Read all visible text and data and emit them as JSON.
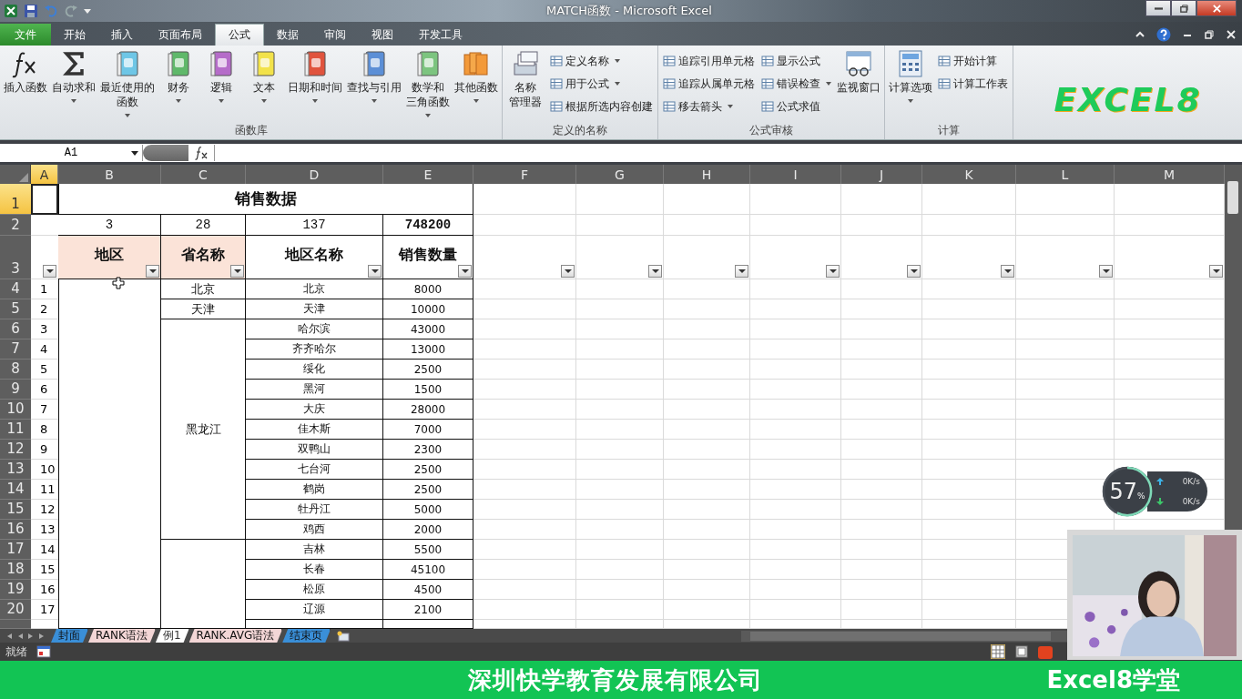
{
  "window": {
    "title": "MATCH函数 - Microsoft Excel"
  },
  "file_menu": {
    "label": "文件"
  },
  "menu_tabs": [
    {
      "label": "开始",
      "selected": false
    },
    {
      "label": "插入",
      "selected": false
    },
    {
      "label": "页面布局",
      "selected": false
    },
    {
      "label": "公式",
      "selected": true
    },
    {
      "label": "数据",
      "selected": false
    },
    {
      "label": "审阅",
      "selected": false
    },
    {
      "label": "视图",
      "selected": false
    },
    {
      "label": "开发工具",
      "selected": false
    }
  ],
  "ribbon": {
    "groups": [
      {
        "label": "函数库",
        "items": [
          {
            "kind": "large",
            "lines": [
              "插入函数"
            ],
            "dropdown": false
          },
          {
            "kind": "large",
            "lines": [
              "自动求和"
            ],
            "dropdown": true
          },
          {
            "kind": "large",
            "lines": [
              "最近使用的",
              "函数"
            ],
            "dropdown": true
          },
          {
            "kind": "large",
            "lines": [
              "财务"
            ],
            "dropdown": true
          },
          {
            "kind": "large",
            "lines": [
              "逻辑"
            ],
            "dropdown": true
          },
          {
            "kind": "large",
            "lines": [
              "文本"
            ],
            "dropdown": true
          },
          {
            "kind": "large",
            "lines": [
              "日期和时间"
            ],
            "dropdown": true
          },
          {
            "kind": "large",
            "lines": [
              "查找与引用"
            ],
            "dropdown": true
          },
          {
            "kind": "large",
            "lines": [
              "数学和",
              "三角函数"
            ],
            "dropdown": true
          },
          {
            "kind": "large",
            "lines": [
              "其他函数"
            ],
            "dropdown": true
          }
        ]
      },
      {
        "label": "定义的名称",
        "items": [
          {
            "kind": "large",
            "lines": [
              "名称",
              "管理器"
            ],
            "dropdown": false
          },
          {
            "kind": "stack",
            "entries": [
              {
                "label": "定义名称",
                "dropdown": true
              },
              {
                "label": "用于公式",
                "dropdown": true
              },
              {
                "label": "根据所选内容创建",
                "dropdown": false
              }
            ]
          }
        ]
      },
      {
        "label": "公式审核",
        "items": [
          {
            "kind": "stack",
            "entries": [
              {
                "label": "追踪引用单元格",
                "dropdown": false
              },
              {
                "label": "追踪从属单元格",
                "dropdown": false
              },
              {
                "label": "移去箭头",
                "dropdown": true
              }
            ]
          },
          {
            "kind": "stack",
            "entries": [
              {
                "label": "显示公式",
                "dropdown": false
              },
              {
                "label": "错误检查",
                "dropdown": true
              },
              {
                "label": "公式求值",
                "dropdown": false
              }
            ]
          },
          {
            "kind": "large",
            "lines": [
              "监视窗口"
            ],
            "dropdown": false
          }
        ]
      },
      {
        "label": "计算",
        "items": [
          {
            "kind": "large",
            "lines": [
              "计算选项"
            ],
            "dropdown": true
          },
          {
            "kind": "stack",
            "entries": [
              {
                "label": "开始计算",
                "dropdown": false
              },
              {
                "label": "计算工作表",
                "dropdown": false
              }
            ]
          }
        ]
      }
    ],
    "logo": "EXCEL8"
  },
  "formula_bar": {
    "name_box": "A1"
  },
  "sheet": {
    "column_headers": [
      {
        "label": "A",
        "selected": true
      },
      {
        "label": "B",
        "selected": false
      },
      {
        "label": "C",
        "selected": false
      },
      {
        "label": "D",
        "selected": false
      },
      {
        "label": "E",
        "selected": false
      },
      {
        "label": "F",
        "selected": false
      },
      {
        "label": "G",
        "selected": false
      },
      {
        "label": "H",
        "selected": false
      },
      {
        "label": "I",
        "selected": false
      },
      {
        "label": "J",
        "selected": false
      },
      {
        "label": "K",
        "selected": false
      },
      {
        "label": "L",
        "selected": false
      },
      {
        "label": "M",
        "selected": false
      }
    ],
    "row_headers": [
      {
        "label": "1",
        "selected": true
      },
      {
        "label": "2",
        "selected": false
      },
      {
        "label": "3",
        "selected": false
      },
      {
        "label": "4",
        "selected": false
      },
      {
        "label": "5",
        "selected": false
      },
      {
        "label": "6",
        "selected": false
      },
      {
        "label": "7",
        "selected": false
      },
      {
        "label": "8",
        "selected": false
      },
      {
        "label": "9",
        "selected": false
      },
      {
        "label": "10",
        "selected": false
      },
      {
        "label": "11",
        "selected": false
      },
      {
        "label": "12",
        "selected": false
      },
      {
        "label": "13",
        "selected": false
      },
      {
        "label": "14",
        "selected": false
      },
      {
        "label": "15",
        "selected": false
      },
      {
        "label": "16",
        "selected": false
      },
      {
        "label": "17",
        "selected": false
      },
      {
        "label": "18",
        "selected": false
      },
      {
        "label": "19",
        "selected": false
      },
      {
        "label": "20",
        "selected": false
      }
    ],
    "title": "销售数据",
    "summary": [
      {
        "text": "3",
        "bold": false
      },
      {
        "text": "28",
        "bold": false
      },
      {
        "text": "137",
        "bold": false
      },
      {
        "text": "748200",
        "bold": true
      }
    ],
    "headers": [
      {
        "label": "地区",
        "highlight": true
      },
      {
        "label": "省名称",
        "highlight": true
      },
      {
        "label": "地区名称",
        "highlight": false
      },
      {
        "label": "销售数量",
        "highlight": false
      }
    ],
    "provinces": [
      {
        "name": "北京",
        "cities": [
          {
            "index": "1",
            "city": "北京",
            "sales": "8000"
          }
        ]
      },
      {
        "name": "天津",
        "cities": [
          {
            "index": "2",
            "city": "天津",
            "sales": "10000"
          }
        ]
      },
      {
        "name": "黑龙江",
        "cities": [
          {
            "index": "3",
            "city": "哈尔滨",
            "sales": "43000"
          },
          {
            "index": "4",
            "city": "齐齐哈尔",
            "sales": "13000"
          },
          {
            "index": "5",
            "city": "绥化",
            "sales": "2500"
          },
          {
            "index": "6",
            "city": "黑河",
            "sales": "1500"
          },
          {
            "index": "7",
            "city": "大庆",
            "sales": "28000"
          },
          {
            "index": "8",
            "city": "佳木斯",
            "sales": "7000"
          },
          {
            "index": "9",
            "city": "双鸭山",
            "sales": "2300"
          },
          {
            "index": "10",
            "city": "七台河",
            "sales": "2500"
          },
          {
            "index": "11",
            "city": "鹤岗",
            "sales": "2500"
          },
          {
            "index": "12",
            "city": "牡丹江",
            "sales": "5000"
          },
          {
            "index": "13",
            "city": "鸡西",
            "sales": "2000"
          }
        ]
      },
      {
        "cities": [
          {
            "index": "14",
            "city": "吉林",
            "sales": "5500"
          },
          {
            "index": "15",
            "city": "长春",
            "sales": "45100"
          },
          {
            "index": "16",
            "city": "松原",
            "sales": "4500"
          },
          {
            "index": "17",
            "city": "辽源",
            "sales": "2100"
          }
        ]
      }
    ]
  },
  "sheet_tabs": [
    {
      "label": "封面",
      "color": "#3a8fd8",
      "selected": false
    },
    {
      "label": "RANK语法",
      "color": "#f3d6d6",
      "selected": false
    },
    {
      "label": "例1",
      "color": "#ffffff",
      "selected": true
    },
    {
      "label": "RANK.AVG语法",
      "color": "#f3d6d6",
      "selected": false
    },
    {
      "label": "结束页",
      "color": "#3a8fd8",
      "selected": false
    }
  ],
  "status_bar": {
    "text": "就绪"
  },
  "net_widget": {
    "percent": "57",
    "unit": "%",
    "upload": "0K/s",
    "download": "0K/s"
  },
  "banner": {
    "company": "深圳快学教育发展有限公司",
    "brand": "Excel8学堂"
  }
}
